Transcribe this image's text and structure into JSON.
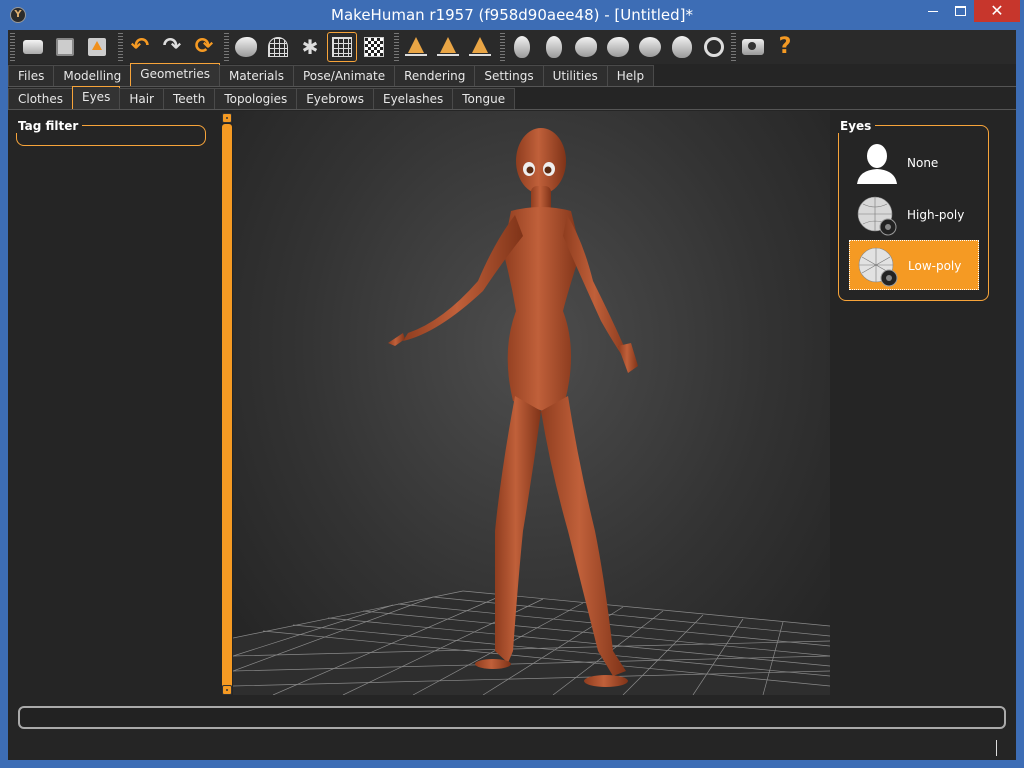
{
  "window": {
    "title": "MakeHuman r1957 (f958d90aee48) - [Untitled]*",
    "minimize_glyph": "▭",
    "maximize_glyph": "▭",
    "close_glyph": "✕",
    "app_icon_glyph": "Y"
  },
  "toolbar": {
    "buttons": [
      {
        "name": "new-icon"
      },
      {
        "name": "save-icon"
      },
      {
        "name": "export-icon"
      },
      {
        "name": "undo-icon"
      },
      {
        "name": "redo-icon"
      },
      {
        "name": "reset-icon"
      },
      {
        "name": "smooth-icon"
      },
      {
        "name": "wireframe-icon"
      },
      {
        "name": "pose-icon"
      },
      {
        "name": "grid-icon",
        "active": true
      },
      {
        "name": "background-icon"
      },
      {
        "name": "symmetry-right-icon"
      },
      {
        "name": "symmetry-left-icon"
      },
      {
        "name": "symmetry-icon"
      },
      {
        "name": "front-view-icon"
      },
      {
        "name": "back-view-icon"
      },
      {
        "name": "left-view-icon"
      },
      {
        "name": "right-view-icon"
      },
      {
        "name": "top-view-icon"
      },
      {
        "name": "bottom-view-icon"
      },
      {
        "name": "reset-camera-icon"
      },
      {
        "name": "screenshot-icon"
      },
      {
        "name": "help-icon"
      }
    ],
    "undo_glyph": "↶",
    "redo_glyph": "↷",
    "reset_glyph": "⟳",
    "help_glyph": "?",
    "pose_glyph": "✱"
  },
  "main_tabs": [
    "Files",
    "Modelling",
    "Geometries",
    "Materials",
    "Pose/Animate",
    "Rendering",
    "Settings",
    "Utilities",
    "Help"
  ],
  "main_tab_active": "Geometries",
  "sub_tabs": [
    "Clothes",
    "Eyes",
    "Hair",
    "Teeth",
    "Topologies",
    "Eyebrows",
    "Eyelashes",
    "Tongue"
  ],
  "sub_tab_active": "Eyes",
  "left_panel": {
    "tag_filter_title": "Tag filter"
  },
  "right_panel": {
    "eyes_title": "Eyes",
    "items": [
      {
        "label": "None",
        "icon": "silhouette-icon"
      },
      {
        "label": "High-poly",
        "icon": "eyeball-icon"
      },
      {
        "label": "Low-poly",
        "icon": "eyeball-icon",
        "selected": true
      }
    ]
  },
  "colors": {
    "accent": "#f59a23",
    "titlebar": "#3d6db5",
    "close": "#c7362c",
    "skin": "#b5542c"
  }
}
